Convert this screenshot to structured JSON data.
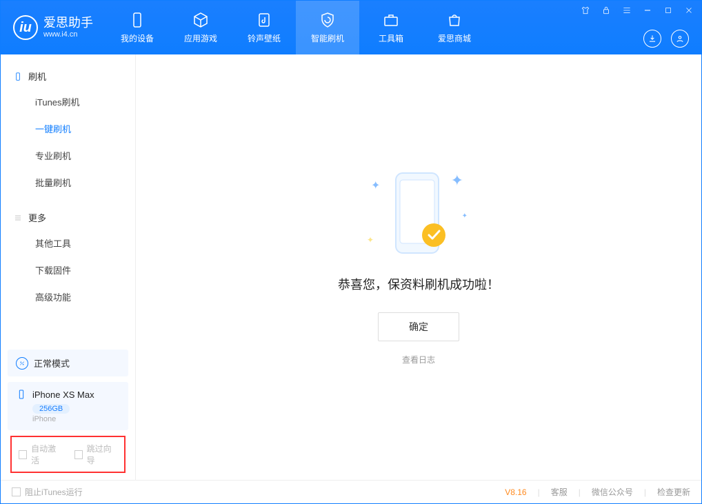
{
  "app": {
    "name": "爱思助手",
    "url": "www.i4.cn"
  },
  "nav": {
    "tabs": [
      {
        "label": "我的设备"
      },
      {
        "label": "应用游戏"
      },
      {
        "label": "铃声壁纸"
      },
      {
        "label": "智能刷机"
      },
      {
        "label": "工具箱"
      },
      {
        "label": "爱思商城"
      }
    ]
  },
  "sidebar": {
    "section1": {
      "title": "刷机",
      "items": [
        {
          "label": "iTunes刷机"
        },
        {
          "label": "一键刷机"
        },
        {
          "label": "专业刷机"
        },
        {
          "label": "批量刷机"
        }
      ]
    },
    "section2": {
      "title": "更多",
      "items": [
        {
          "label": "其他工具"
        },
        {
          "label": "下载固件"
        },
        {
          "label": "高级功能"
        }
      ]
    },
    "mode": "正常模式",
    "device": {
      "name": "iPhone XS Max",
      "capacity": "256GB",
      "type": "iPhone"
    },
    "checkboxes": {
      "autoActivate": "自动激活",
      "skipGuide": "跳过向导"
    }
  },
  "main": {
    "successText": "恭喜您，保资料刷机成功啦！",
    "confirmLabel": "确定",
    "viewLogLabel": "查看日志"
  },
  "footer": {
    "blockItunes": "阻止iTunes运行",
    "version": "V8.16",
    "links": {
      "service": "客服",
      "wechat": "微信公众号",
      "update": "检查更新"
    }
  }
}
